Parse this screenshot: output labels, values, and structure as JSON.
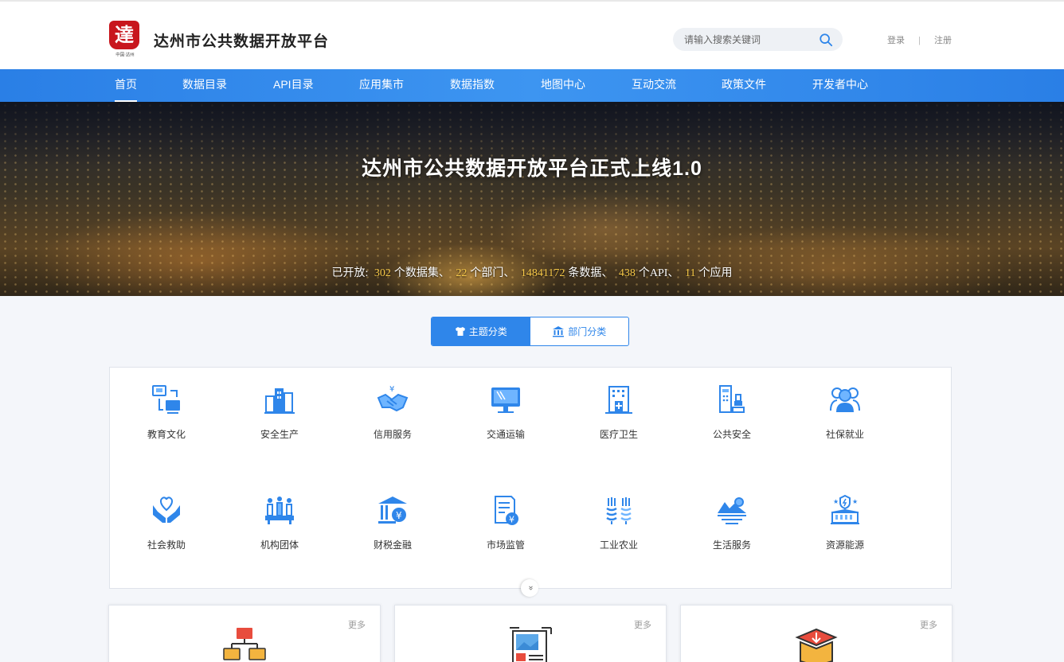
{
  "header": {
    "logo_char": "達",
    "logo_sub": "中国·达州",
    "title": "达州市公共数据开放平台",
    "search_placeholder": "请输入搜索关键词",
    "login": "登录",
    "separator": "|",
    "register": "注册"
  },
  "nav": {
    "items": [
      "首页",
      "数据目录",
      "API目录",
      "应用集市",
      "数据指数",
      "地图中心",
      "互动交流",
      "政策文件",
      "开发者中心"
    ],
    "active": "首页"
  },
  "banner": {
    "title": "达州市公共数据开放平台正式上线1.0",
    "stats_prefix": "已开放:",
    "datasets": "302",
    "datasets_unit": "个数据集、",
    "departments": "22",
    "departments_unit": "个部门、",
    "records": "14841172",
    "records_unit": "条数据、",
    "apis": "438",
    "apis_unit": "个API、",
    "apps": "11",
    "apps_unit": "个应用"
  },
  "toggle": {
    "theme": "主题分类",
    "department": "部门分类"
  },
  "categories": [
    {
      "label": "教育文化",
      "icon": "education-icon"
    },
    {
      "label": "安全生产",
      "icon": "safety-production-icon"
    },
    {
      "label": "信用服务",
      "icon": "credit-service-icon"
    },
    {
      "label": "交通运输",
      "icon": "transport-icon"
    },
    {
      "label": "医疗卫生",
      "icon": "medical-icon"
    },
    {
      "label": "公共安全",
      "icon": "public-security-icon"
    },
    {
      "label": "社保就业",
      "icon": "social-security-icon"
    },
    {
      "label": "社会救助",
      "icon": "social-aid-icon"
    },
    {
      "label": "机构团体",
      "icon": "organization-icon"
    },
    {
      "label": "财税金融",
      "icon": "finance-icon"
    },
    {
      "label": "市场监管",
      "icon": "market-supervision-icon"
    },
    {
      "label": "工业农业",
      "icon": "industry-agriculture-icon"
    },
    {
      "label": "生活服务",
      "icon": "life-service-icon"
    },
    {
      "label": "资源能源",
      "icon": "resource-energy-icon"
    }
  ],
  "expand_glyph": "»",
  "cards": [
    {
      "more": "更多",
      "icon": "network-icon"
    },
    {
      "more": "更多",
      "icon": "gallery-icon"
    },
    {
      "more": "更多",
      "icon": "box-icon"
    }
  ],
  "colors": {
    "primary": "#2f86ea",
    "stat_highlight": "#f7c948",
    "logo_red": "#c8161d"
  }
}
